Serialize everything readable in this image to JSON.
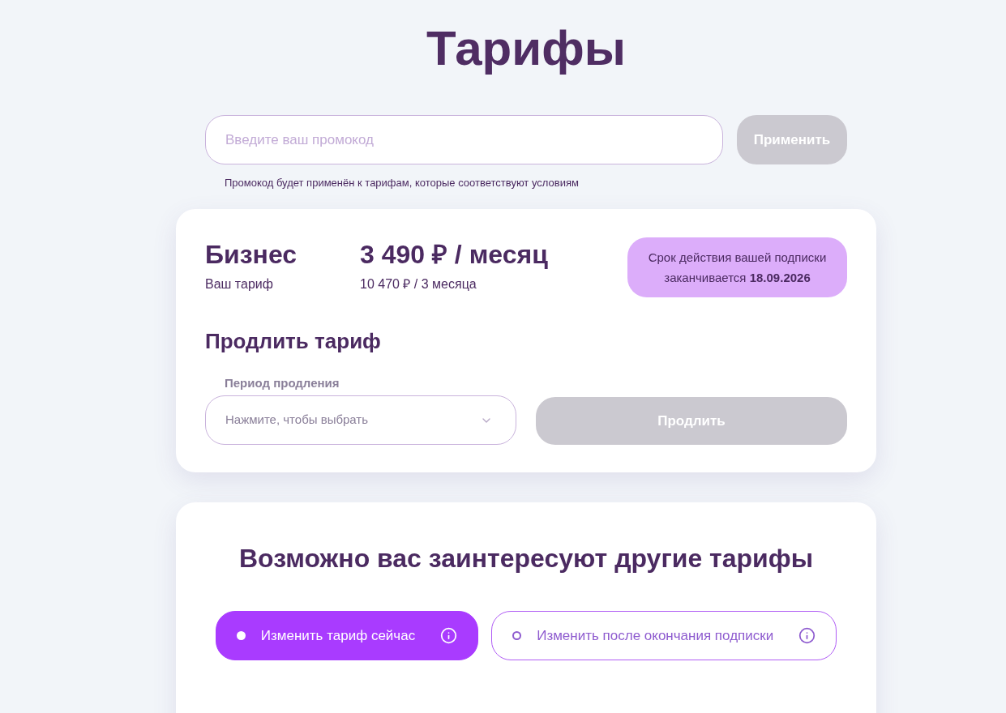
{
  "page": {
    "title": "Тарифы"
  },
  "promo": {
    "placeholder": "Введите ваш промокод",
    "button": {
      "label": "Применить",
      "disabled": true
    },
    "hint": "Промокод будет применён к тарифам, которые соответствуют условиям"
  },
  "current_plan": {
    "name": "Бизнес",
    "caption": "Ваш тариф",
    "price": "3 490 ₽ / месяц",
    "price_note": "10 470 ₽ / 3 месяца",
    "expiry_notice": "Срок действия вашей подписки заканчивается **18.09.2026**"
  },
  "renew": {
    "heading": "Продлить тариф",
    "period_label": "Период продления",
    "period_placeholder": "Нажмите, чтобы выбрать",
    "button": {
      "label": "Продлить",
      "disabled": true
    }
  },
  "other_plans": {
    "heading": "Возможно вас заинтересуют другие тарифы",
    "switch_options": [
      {
        "label": "Изменить тариф сейчас",
        "selected": true
      },
      {
        "label": "Изменить после окончания подписки",
        "selected": false
      }
    ]
  }
}
